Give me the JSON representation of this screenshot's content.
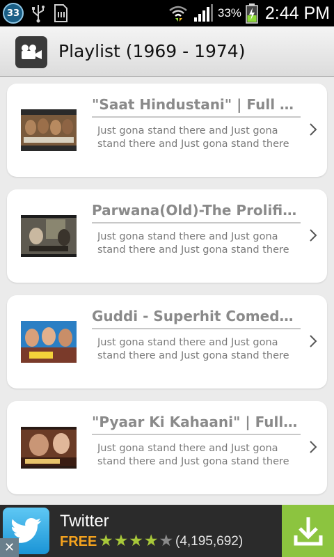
{
  "status_bar": {
    "notification_count": "33",
    "battery_percent": "33%",
    "time": "2:44 PM"
  },
  "header": {
    "title": "Playlist (1969 - 1974)",
    "icon": "video-camera-icon"
  },
  "playlist": [
    {
      "title": "\"Saat Hindustani\" | Full Mo...",
      "description": "Just gona stand there and Just gona stand there and Just gona stand there and Just"
    },
    {
      "title": "Parwana(Old)-The Prolific...",
      "description": "Just gona stand there and Just gona stand there and Just gona stand there and Just"
    },
    {
      "title": "Guddi - Superhit Comedy...",
      "description": "Just gona stand there and Just gona stand there and Just gona stand there and Just"
    },
    {
      "title": "\"Pyaar Ki Kahaani\" | Full Hi...",
      "description": "Just gona stand there and Just gona stand there and Just gona stand there and Just"
    }
  ],
  "ad": {
    "app_name": "Twitter",
    "price": "FREE",
    "rating_stars": 4,
    "rating_count": "(4,195,692)",
    "icon": "twitter-bird-icon",
    "accent_color": "#8cc43f",
    "price_color": "#f4a21e"
  }
}
